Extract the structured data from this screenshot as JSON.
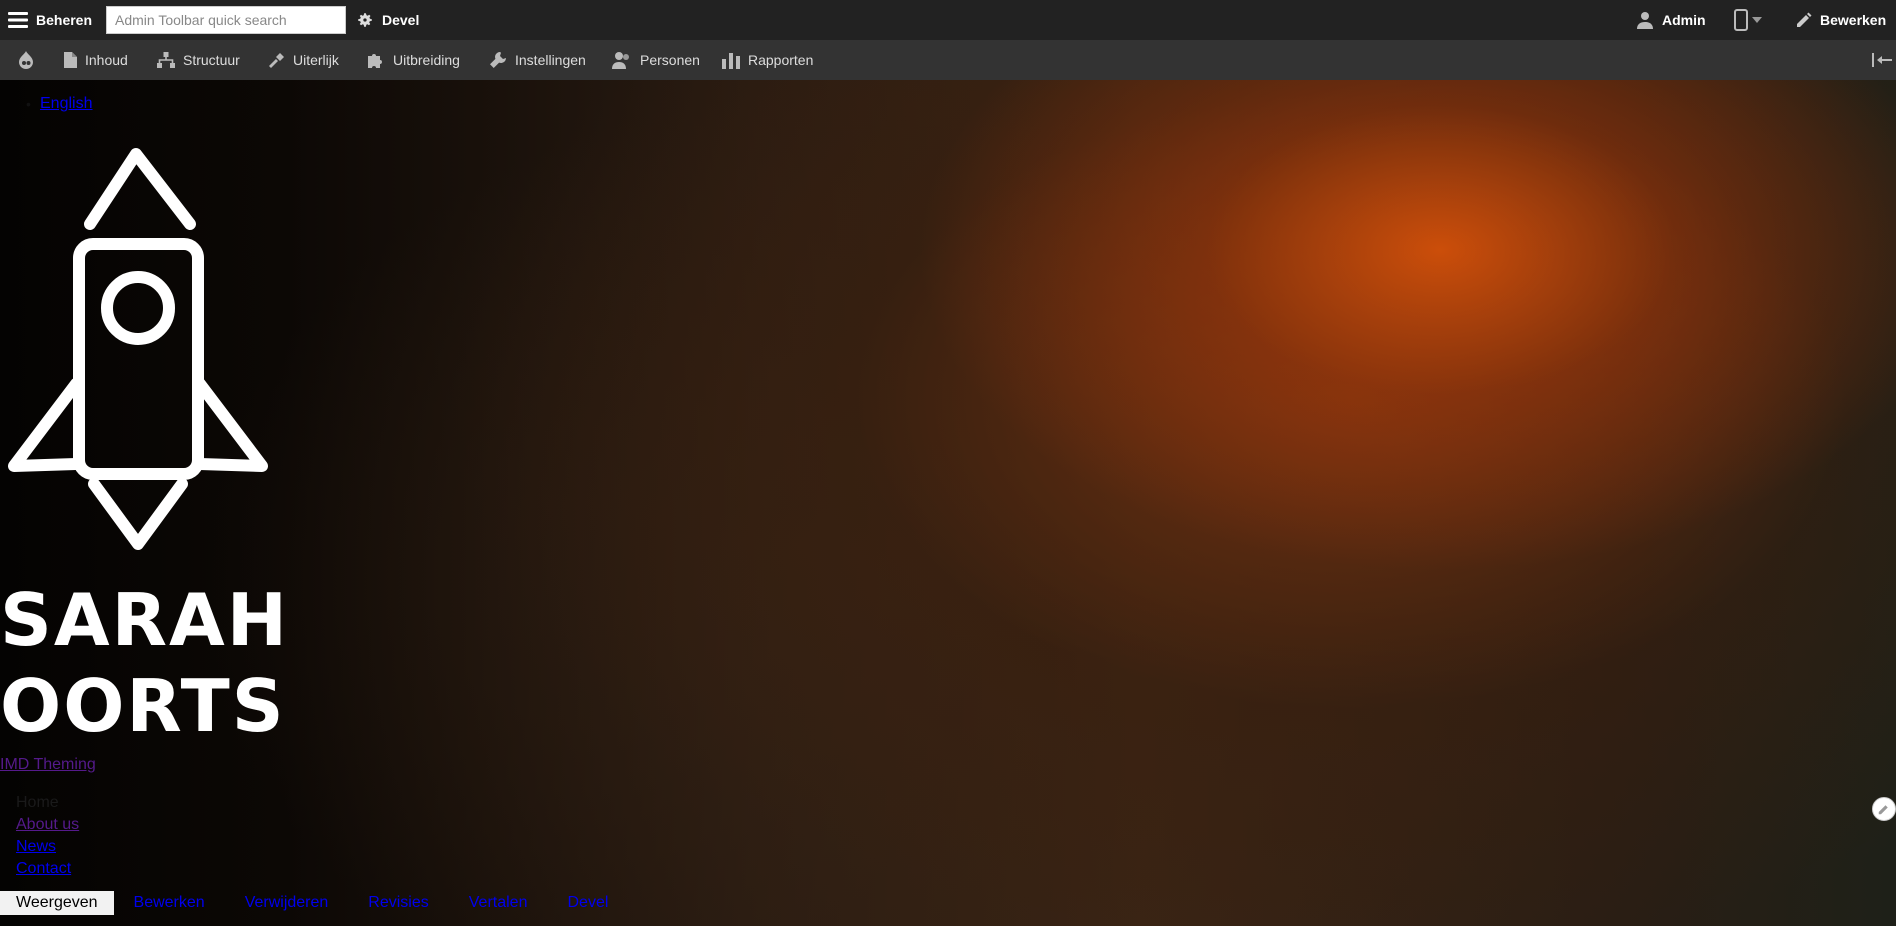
{
  "toolbar": {
    "manage_label": "Beheren",
    "search_placeholder": "Admin Toolbar quick search",
    "devel_label": "Devel",
    "user_label": "Admin",
    "edit_label": "Bewerken"
  },
  "tray": {
    "items": [
      {
        "label": "Inhoud",
        "icon": "file-icon"
      },
      {
        "label": "Structuur",
        "icon": "sitemap-icon"
      },
      {
        "label": "Uiterlijk",
        "icon": "paintbrush-icon"
      },
      {
        "label": "Uitbreiding",
        "icon": "puzzle-icon"
      },
      {
        "label": "Instellingen",
        "icon": "wrench-icon"
      },
      {
        "label": "Personen",
        "icon": "people-icon"
      },
      {
        "label": "Rapporten",
        "icon": "bar-chart-icon"
      }
    ]
  },
  "page": {
    "language_link": "English",
    "site_name_line1": "SARAH",
    "site_name_line2": "OORTS",
    "slogan": "IMD Theming",
    "menu": [
      "Home",
      "About us",
      "News",
      "Contact"
    ]
  },
  "tabs": [
    "Weergeven",
    "Bewerken",
    "Verwijderen",
    "Revisies",
    "Vertalen",
    "Devel"
  ],
  "colors": {
    "toolbar_bg": "#222222",
    "tray_bg": "#333333",
    "link_blue": "#0000ee",
    "visited_purple": "#551a8b"
  }
}
